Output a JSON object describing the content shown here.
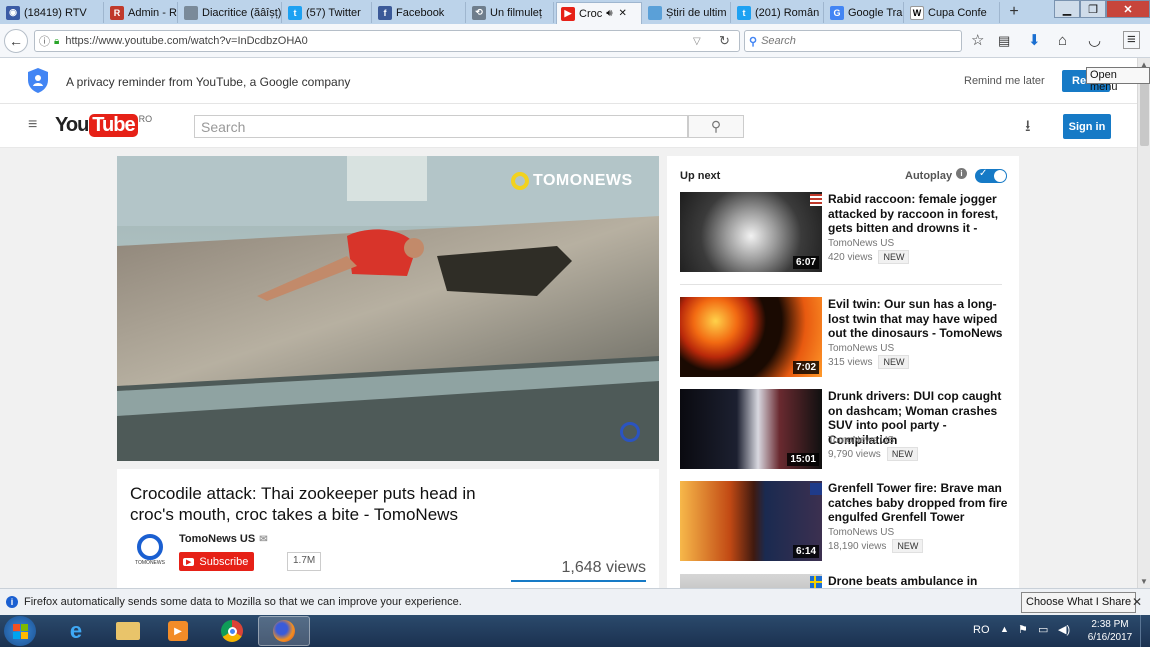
{
  "browser": {
    "tabs": [
      {
        "label": "(18419) RTV",
        "fav_color": "#3b5ba5",
        "fav_glyph": "◉"
      },
      {
        "label": "Admin - RTV",
        "fav_color": "#c0392b",
        "fav_glyph": "R"
      },
      {
        "label": "Diacritice (ăâîșț)",
        "fav_color": "#7a8a99",
        "fav_glyph": ""
      },
      {
        "label": "(57) Twitter",
        "fav_color": "#1da1f2",
        "fav_glyph": "t"
      },
      {
        "label": "Facebook",
        "fav_color": "#3b5998",
        "fav_glyph": "f"
      },
      {
        "label": "Un filmuleț",
        "fav_color": "#6e7d8c",
        "fav_glyph": "⟲"
      },
      {
        "label": "Croc",
        "fav_color": "#e62117",
        "fav_glyph": "▶"
      },
      {
        "label": "Știri de ultim",
        "fav_color": "#5aa0d8",
        "fav_glyph": ""
      },
      {
        "label": "(201) Român",
        "fav_color": "#1da1f2",
        "fav_glyph": "t"
      },
      {
        "label": "Google Tran",
        "fav_color": "#4285f4",
        "fav_glyph": "G"
      },
      {
        "label": "Cupa Confe",
        "fav_color": "#ffffff",
        "fav_glyph": "W"
      }
    ],
    "new_tab": "+",
    "url": "https://www.youtube.com/watch?v=InDcdbzOHA0",
    "search_placeholder": "Search",
    "tooltip": "Open menu"
  },
  "privacy": {
    "text": "A privacy reminder from YouTube, a Google company",
    "remind": "Remind me later",
    "review": "Review"
  },
  "youtube": {
    "logo_you": "You",
    "logo_tube": "Tube",
    "region": "RO",
    "search_placeholder": "Search",
    "signin": "Sign in"
  },
  "video": {
    "watermark": "TOMONEWS",
    "title": "Crocodile attack: Thai zookeeper puts head in croc's mouth, croc takes a bite - TomoNews",
    "channel": "TomoNews US",
    "channel_logo_text": "TOMONEWS",
    "subscribe": "Subscribe",
    "subs": "1.7M",
    "views": "1,648 views"
  },
  "sidebar": {
    "upnext": "Up next",
    "autoplay": "Autoplay",
    "items": [
      {
        "title": "Rabid raccoon: female jogger attacked by raccoon in forest, gets bitten and drowns it -",
        "channel": "TomoNews US",
        "views": "420 views",
        "badge": "NEW",
        "duration": "6:07"
      },
      {
        "title": "Evil twin: Our sun has a long-lost twin that may have wiped out the dinosaurs - TomoNews",
        "channel": "TomoNews US",
        "views": "315 views",
        "badge": "NEW",
        "duration": "7:02"
      },
      {
        "title": "Drunk drivers: DUI cop caught on dashcam; Woman crashes SUV into pool party - Compilation",
        "channel": "TomoNews US",
        "views": "9,790 views",
        "badge": "NEW",
        "duration": "15:01"
      },
      {
        "title": "Grenfell Tower fire: Brave man catches baby dropped from fire engulfed Grenfell Tower",
        "channel": "TomoNews US",
        "views": "18,190 views",
        "badge": "NEW",
        "duration": "6:14"
      },
      {
        "title": "Drone beats ambulance in"
      }
    ]
  },
  "notification": {
    "text": "Firefox automatically sends some data to Mozilla so that we can improve your experience.",
    "button": "Choose What I Share"
  },
  "taskbar": {
    "lang": "RO",
    "time": "2:38 PM",
    "date": "6/16/2017"
  }
}
